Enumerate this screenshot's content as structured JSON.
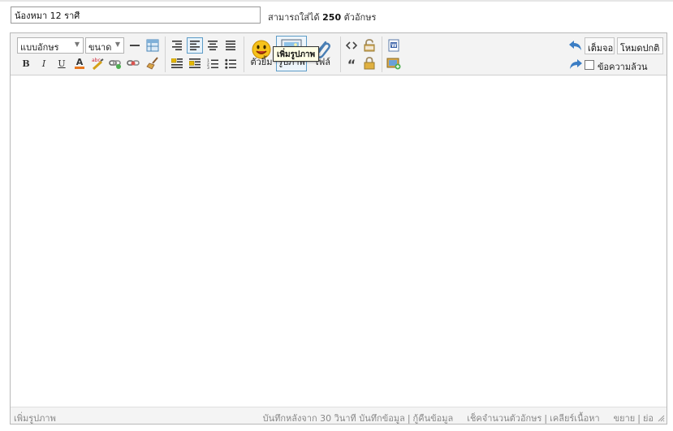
{
  "title_field": {
    "value": "น้องหมา 12 ราศี"
  },
  "title_hint": {
    "prefix": "สามารถใส่ได้",
    "count": "250",
    "suffix": "ตัวอักษร"
  },
  "toolbar": {
    "font_select": "แบบอักษร",
    "size_select": "ขนาด",
    "bold": "B",
    "italic": "I",
    "underline": "U",
    "font_color": "A",
    "emoticon_label": "ตัวยิ้ม",
    "image_label": "รูปภาพ",
    "file_label": "ไฟล์",
    "quote": "“",
    "fullscreen_label": "เต็มจอ",
    "normal_mode_label": "โหมดปกติ",
    "plain_text_label": "ข้อความล้วน",
    "plain_text_checked": false
  },
  "tooltip": "เพิ่มรูปภาพ",
  "content": "",
  "statusbar": {
    "left": "เพิ่มรูปภาพ",
    "autosave": "บันทึกหลังจาก 30 วินาที",
    "save": "บันทึกข้อมูล",
    "restore": "กู้คืนข้อมูล",
    "count_chars": "เช็คจำนวนตัวอักษร",
    "clear": "เคลียร์เนื้อหา",
    "expand": "ขยาย",
    "shrink": "ย่อ",
    "separator": "|"
  },
  "colors": {
    "accent": "#5d9cc7",
    "toolbar_bg": "#f3f3f3",
    "tooltip_bg": "#ffffe6"
  }
}
